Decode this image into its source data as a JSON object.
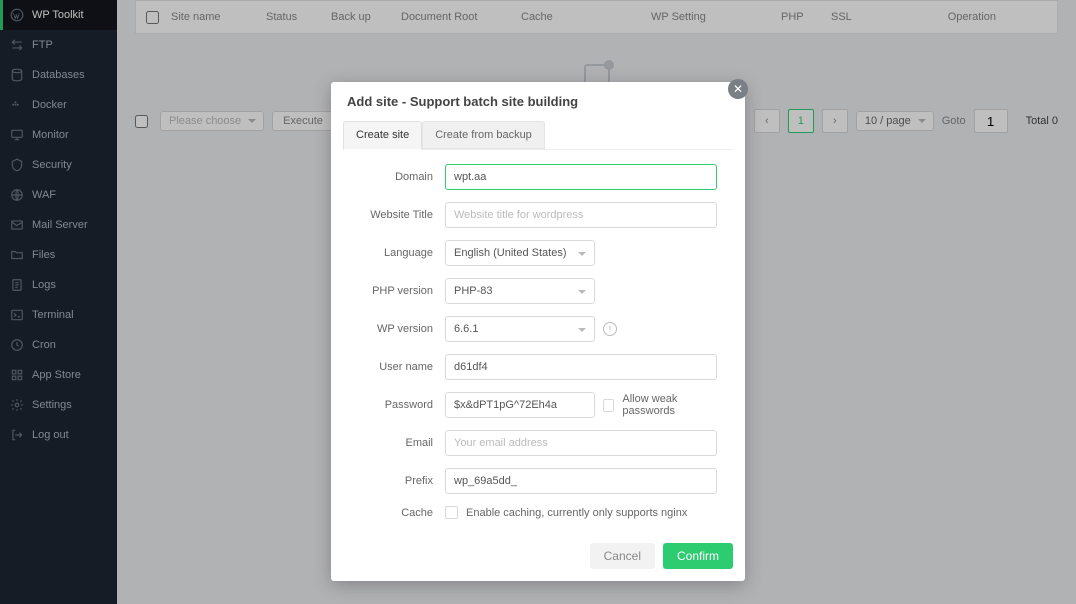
{
  "sidebar": {
    "items": [
      {
        "label": "WP Toolkit",
        "icon": "wordpress-icon"
      },
      {
        "label": "FTP",
        "icon": "ftp-icon"
      },
      {
        "label": "Databases",
        "icon": "database-icon"
      },
      {
        "label": "Docker",
        "icon": "docker-icon"
      },
      {
        "label": "Monitor",
        "icon": "monitor-icon"
      },
      {
        "label": "Security",
        "icon": "security-icon"
      },
      {
        "label": "WAF",
        "icon": "waf-icon"
      },
      {
        "label": "Mail Server",
        "icon": "mail-icon"
      },
      {
        "label": "Files",
        "icon": "files-icon"
      },
      {
        "label": "Logs",
        "icon": "logs-icon"
      },
      {
        "label": "Terminal",
        "icon": "terminal-icon"
      },
      {
        "label": "Cron",
        "icon": "cron-icon"
      },
      {
        "label": "App Store",
        "icon": "appstore-icon"
      },
      {
        "label": "Settings",
        "icon": "settings-icon"
      },
      {
        "label": "Log out",
        "icon": "logout-icon"
      }
    ]
  },
  "table": {
    "columns": [
      "Site name",
      "Status",
      "Back up",
      "Document Root",
      "Cache",
      "WP Setting",
      "PHP",
      "SSL",
      "Operation"
    ]
  },
  "footer": {
    "bulk_placeholder": "Please choose",
    "execute": "Execute",
    "page_size": "10 / page",
    "page_current": "1",
    "goto_label": "Goto",
    "goto_value": "1",
    "total_label": "Total 0"
  },
  "modal": {
    "title": "Add site - Support batch site building",
    "tabs": [
      "Create site",
      "Create from backup"
    ],
    "fields": {
      "domain": {
        "label": "Domain",
        "value": "wpt.aa"
      },
      "title": {
        "label": "Website Title",
        "placeholder": "Website title for wordpress"
      },
      "lang": {
        "label": "Language",
        "value": "English (United States)"
      },
      "phpver": {
        "label": "PHP version",
        "value": "PHP-83"
      },
      "wpver": {
        "label": "WP version",
        "value": "6.6.1"
      },
      "user": {
        "label": "User name",
        "value": "d61df4"
      },
      "pass": {
        "label": "Password",
        "value": "$x&dPT1pG^72Eh4a",
        "allow_weak": "Allow weak passwords"
      },
      "email": {
        "label": "Email",
        "placeholder": "Your email address"
      },
      "prefix": {
        "label": "Prefix",
        "value": "wp_69a5dd_"
      },
      "cache": {
        "label": "Cache",
        "note": "Enable caching, currently only supports nginx"
      }
    },
    "cancel": "Cancel",
    "confirm": "Confirm"
  }
}
